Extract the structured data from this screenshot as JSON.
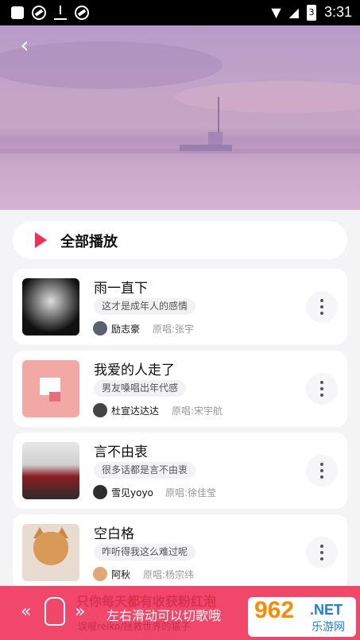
{
  "status_bar": {
    "time": "3:31",
    "battery": "3"
  },
  "header": {
    "back_icon": "chevron-left-icon",
    "back_glyph": "‹"
  },
  "play_all": {
    "label": "全部播放",
    "accent": "#f0305b"
  },
  "songs": [
    {
      "title": "雨一直下",
      "tag": "这才是成年人的感情",
      "singer": "励志豪",
      "original": "原唱:张宇"
    },
    {
      "title": "我爱的人走了",
      "tag": "男友嗓唱出年代感",
      "singer": "杜宣达达达",
      "original": "原唱:宋宇航"
    },
    {
      "title": "言不由衷",
      "tag": "很多话都是言不由衷",
      "singer": "雪见yoyo",
      "original": "原唱:徐佳莹"
    },
    {
      "title": "空白格",
      "tag": "咋听得我这么难过呢",
      "singer": "阿秋",
      "original": "原唱:杨宗纬"
    }
  ],
  "banner": {
    "now_playing_title": "只你每天都有收获粉红泡",
    "now_playing_sub": "误喔reiko/拯救世界的猫子",
    "hint": "左右滑动可以切歌哦",
    "arrows_left": "«",
    "arrows_right": "»",
    "logo_main": "962",
    "logo_net": ".NET",
    "logo_cn": "乐游网",
    "color": "#f0476a"
  }
}
